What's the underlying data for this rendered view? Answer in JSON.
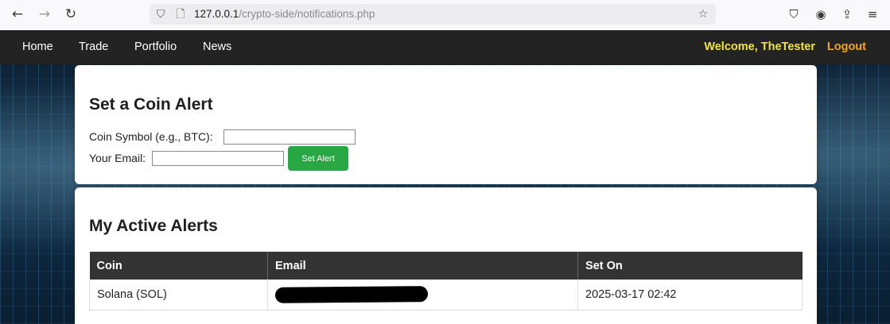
{
  "browser": {
    "url_host": "127.0.0.1",
    "url_path": "/crypto-side/notifications.php"
  },
  "nav": {
    "links": [
      "Home",
      "Trade",
      "Portfolio",
      "News"
    ],
    "welcome": "Welcome, TheTester",
    "logout": "Logout"
  },
  "alert_form": {
    "title": "Set a Coin Alert",
    "coin_label": "Coin Symbol (e.g., BTC):",
    "email_label": "Your Email:",
    "coin_value": "",
    "email_value": "",
    "button_label": "Set Alert"
  },
  "active_alerts": {
    "title": "My Active Alerts",
    "columns": [
      "Coin",
      "Email",
      "Set On"
    ],
    "rows": [
      {
        "coin": "Solana (SOL)",
        "email": "",
        "set_on": "2025-03-17 02:42"
      }
    ]
  },
  "colors": {
    "navbar": "#232323",
    "welcome": "#f1e43a",
    "logout": "#f2a51c",
    "button": "#28a745",
    "table_header": "#333333"
  }
}
